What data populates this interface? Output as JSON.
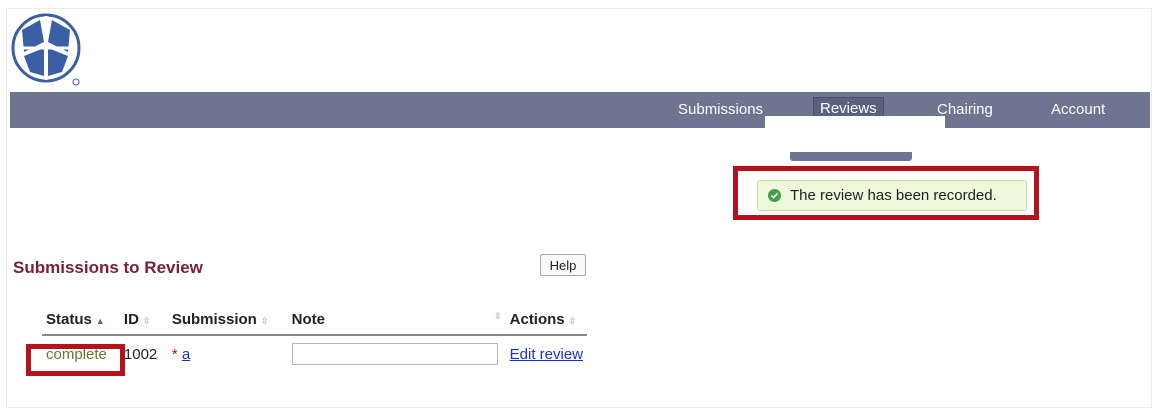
{
  "nav": {
    "items": [
      {
        "label": "Submissions"
      },
      {
        "label": "Reviews"
      },
      {
        "label": "Chairing"
      },
      {
        "label": "Account"
      }
    ],
    "active": "Reviews"
  },
  "message": {
    "text": "The review has been recorded.",
    "color": "#43a047"
  },
  "section": {
    "title": "Submissions to Review",
    "help_label": "Help"
  },
  "table": {
    "columns": [
      "Status",
      "ID",
      "Submission",
      "Note",
      "Actions"
    ],
    "rows": [
      {
        "status": "complete",
        "id": "1002",
        "star": "*",
        "submission": "a",
        "note_value": "",
        "action": "Edit review"
      }
    ]
  },
  "colors": {
    "nav_bg": "#6e7590",
    "highlight": "#b3121f",
    "title": "#7a1e3a",
    "link": "#1c2fd6"
  }
}
